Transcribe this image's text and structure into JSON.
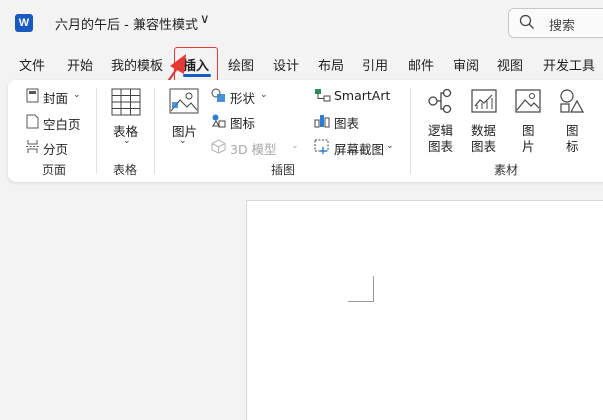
{
  "app": {
    "logo_letter": "W",
    "doc_title": "六月的午后  -  兼容性模式",
    "title_chevron": "∨"
  },
  "search": {
    "label": "搜索"
  },
  "tabs": [
    {
      "label": "文件"
    },
    {
      "label": "开始"
    },
    {
      "label": "我的模板"
    },
    {
      "label": "插入"
    },
    {
      "label": "绘图"
    },
    {
      "label": "设计"
    },
    {
      "label": "布局"
    },
    {
      "label": "引用"
    },
    {
      "label": "邮件"
    },
    {
      "label": "审阅"
    },
    {
      "label": "视图"
    },
    {
      "label": "开发工具"
    }
  ],
  "ribbon": {
    "pages_group": {
      "cover": "封面",
      "blank": "空白页",
      "break": "分页",
      "label": "页面"
    },
    "tables_group": {
      "table": "表格",
      "label": "表格"
    },
    "illustrations_group": {
      "picture": "图片",
      "shapes": "形状",
      "icons": "图标",
      "model3d": "3D 模型",
      "smartart": "SmartArt",
      "chart": "图表",
      "screenshot": "屏幕截图",
      "label": "插图"
    },
    "material_group": {
      "logic_chart_l1": "逻辑",
      "logic_chart_l2": "图表",
      "data_chart_l1": "数据",
      "data_chart_l2": "图表",
      "image_l1": "图",
      "image_l2": "片",
      "icon_l1": "图",
      "icon_l2": "标",
      "label": "素材"
    }
  },
  "colors": {
    "accent": "#185abd",
    "highlight": "#e53935"
  }
}
